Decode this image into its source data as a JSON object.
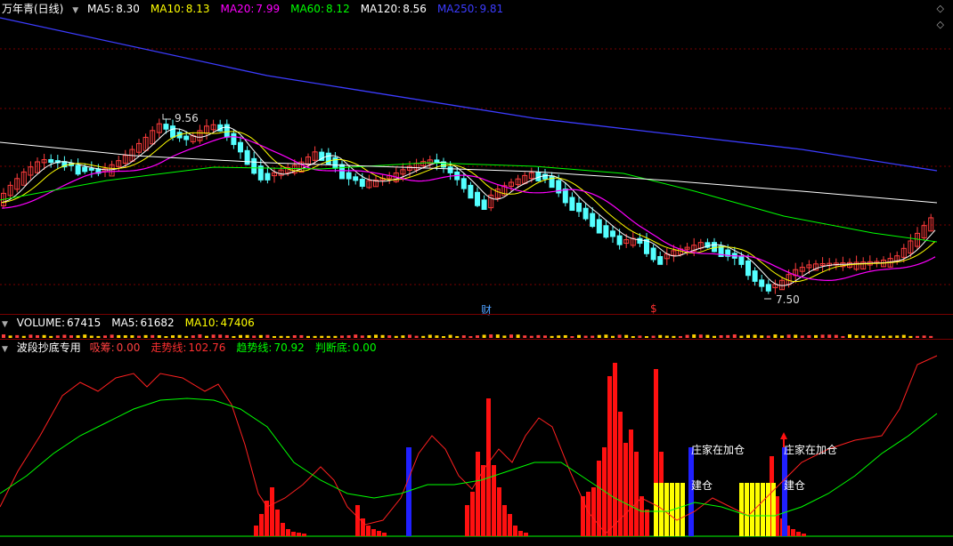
{
  "main_legend": {
    "title": "万年青(日线)",
    "items": [
      {
        "label": "MA5:",
        "value": "8.30",
        "color": "#ffffff"
      },
      {
        "label": "MA10:",
        "value": "8.13",
        "color": "#ffff00"
      },
      {
        "label": "MA20:",
        "value": "7.99",
        "color": "#ff00ff"
      },
      {
        "label": "MA60:",
        "value": "8.12",
        "color": "#00ff00"
      },
      {
        "label": "MA120:",
        "value": "8.56",
        "color": "#ffffff"
      },
      {
        "label": "MA250:",
        "value": "9.81",
        "color": "#3c3cff"
      }
    ]
  },
  "main_annotations": {
    "high": "9.56",
    "low": "7.50",
    "cai_marker": "财",
    "s_marker": "$"
  },
  "volume_legend": {
    "items": [
      {
        "label": "VOLUME:",
        "value": "67415",
        "color": "#ffffff"
      },
      {
        "label": "MA5:",
        "value": "61682",
        "color": "#ffffff"
      },
      {
        "label": "MA10:",
        "value": "47406",
        "color": "#ffff00"
      }
    ]
  },
  "indicator_legend": {
    "title": "波段抄底专用",
    "items": [
      {
        "label": "吸筹:",
        "value": "0.00",
        "color": "#ff4040"
      },
      {
        "label": "走势线:",
        "value": "102.76",
        "color": "#ff3030"
      },
      {
        "label": "趋势线:",
        "value": "70.92",
        "color": "#00ff00"
      },
      {
        "label": "判断底:",
        "value": "0.00",
        "color": "#00ff00"
      }
    ]
  },
  "indicator_annotations": {
    "label1": "庄家在加仓",
    "label2": "建仓",
    "label3": "庄家在加仓",
    "label4": "建仓"
  },
  "colors": {
    "up": "#ff3c3c",
    "down": "#54ffff",
    "grid": "#7a0000",
    "ma5": "#ffffff",
    "ma10": "#ffff00",
    "ma20": "#ff00ff",
    "ma60": "#00ff00",
    "ma120": "#ffffff",
    "ma250": "#3c3cff"
  }
}
